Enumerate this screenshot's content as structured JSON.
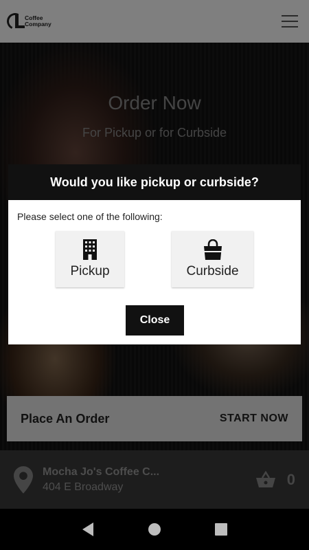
{
  "header": {
    "logo_line1": "Coffee",
    "logo_line2": "Company",
    "menu_icon": "hamburger-menu-icon"
  },
  "hero": {
    "title": "Order Now",
    "subtitle": "For Pickup or for Curbside"
  },
  "place_order": {
    "label": "Place An Order",
    "cta": "START NOW"
  },
  "modal": {
    "title": "Would you like pickup or curbside?",
    "prompt": "Please select one of the following:",
    "options": [
      {
        "label": "Pickup",
        "icon": "building-icon"
      },
      {
        "label": "Curbside",
        "icon": "shopping-bag-icon"
      }
    ],
    "close_label": "Close"
  },
  "footer": {
    "store_name": "Mocha Jo's Coffee C...",
    "store_address": "404 E Broadway",
    "location_icon": "location-pin-icon",
    "cart_icon": "basket-icon",
    "cart_count": "0"
  },
  "colors": {
    "modal_header": "#111111",
    "footer_bg": "#3a3a3a",
    "button_bg": "#111111"
  }
}
